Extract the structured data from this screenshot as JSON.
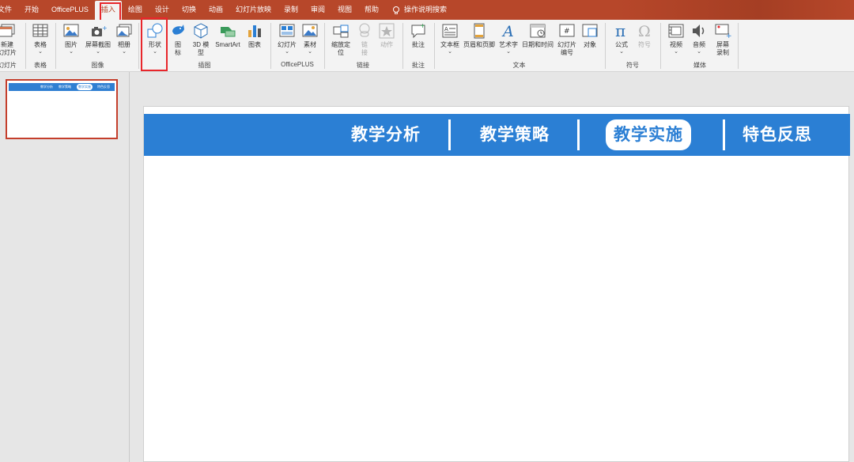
{
  "menu": {
    "tabs": [
      "文件",
      "开始",
      "OfficePLUS",
      "插入",
      "绘图",
      "设计",
      "切换",
      "动画",
      "幻灯片放映",
      "录制",
      "审阅",
      "视图",
      "帮助"
    ],
    "active_tab": "插入",
    "search_label": "操作说明搜索"
  },
  "ribbon": {
    "new_slide": "新建\n幻灯片",
    "new_slide_line1": "新建",
    "new_slide_line2": "幻灯片",
    "table": "表格",
    "picture": "图片",
    "screenshot": "屏幕截图",
    "album": "相册",
    "shapes": "形状",
    "icons_line1": "图",
    "icons_line2": "标",
    "model3d_line1": "3D 模",
    "model3d_line2": "型",
    "smartart": "SmartArt",
    "chart": "图表",
    "op_slides": "幻灯片",
    "op_material": "素材",
    "zoom_line1": "缩放定",
    "zoom_line2": "位",
    "link_line1": "链",
    "link_line2": "接",
    "action": "动作",
    "comment": "批注",
    "textbox": "文本框",
    "header_footer": "页眉和页脚",
    "wordart": "艺术字",
    "datetime": "日期和时间",
    "slide_number_line1": "幻灯片",
    "slide_number_line2": "编号",
    "object": "对象",
    "equation": "公式",
    "symbol": "符号",
    "video": "视频",
    "audio": "音频",
    "screen_record_line1": "屏幕",
    "screen_record_line2": "录制",
    "groups": {
      "slides": "幻灯片",
      "tables": "表格",
      "images": "图像",
      "illustrations": "插图",
      "officeplus": "OfficePLUS",
      "links": "链接",
      "comments": "批注",
      "text": "文本",
      "symbols": "符号",
      "media": "媒体"
    }
  },
  "slide": {
    "nav": [
      "教学分析",
      "教学策略",
      "教学实施",
      "特色反思"
    ],
    "selected_index": 2
  },
  "colors": {
    "accent": "#b7472a",
    "banner_blue": "#2b7fd4",
    "highlight_red": "#e8262b"
  }
}
